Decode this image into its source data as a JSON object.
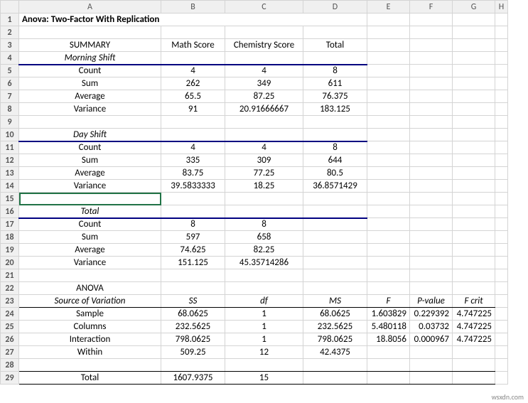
{
  "columns": [
    "A",
    "B",
    "C",
    "D",
    "E",
    "F",
    "G",
    "H"
  ],
  "rows": [
    "1",
    "2",
    "3",
    "4",
    "5",
    "6",
    "7",
    "8",
    "9",
    "10",
    "11",
    "12",
    "13",
    "14",
    "15",
    "16",
    "17",
    "18",
    "19",
    "20",
    "21",
    "22",
    "23",
    "24",
    "25",
    "26",
    "27",
    "28",
    "29"
  ],
  "title": "Anova: Two-Factor With Replication",
  "summary_label": "SUMMARY",
  "headers": {
    "math": "Math Score",
    "chem": "Chemistry Score",
    "total": "Total"
  },
  "sections": {
    "morning": {
      "label": "Morning Shift",
      "count": {
        "label": "Count",
        "b": "4",
        "c": "4",
        "d": "8"
      },
      "sum": {
        "label": "Sum",
        "b": "262",
        "c": "349",
        "d": "611"
      },
      "avg": {
        "label": "Average",
        "b": "65.5",
        "c": "87.25",
        "d": "76.375"
      },
      "var": {
        "label": "Variance",
        "b": "91",
        "c": "20.91666667",
        "d": "183.125"
      }
    },
    "day": {
      "label": "Day Shift",
      "count": {
        "label": "Count",
        "b": "4",
        "c": "4",
        "d": "8"
      },
      "sum": {
        "label": "Sum",
        "b": "335",
        "c": "309",
        "d": "644"
      },
      "avg": {
        "label": "Average",
        "b": "83.75",
        "c": "77.25",
        "d": "80.5"
      },
      "var": {
        "label": "Variance",
        "b": "39.5833333",
        "c": "18.25",
        "d": "36.8571429"
      }
    },
    "total": {
      "label": "Total",
      "count": {
        "label": "Count",
        "b": "8",
        "c": "8"
      },
      "sum": {
        "label": "Sum",
        "b": "597",
        "c": "658"
      },
      "avg": {
        "label": "Average",
        "b": "74.625",
        "c": "82.25"
      },
      "var": {
        "label": "Variance",
        "b": "151.125",
        "c": "45.35714286"
      }
    }
  },
  "anova": {
    "label": "ANOVA",
    "headers": {
      "src": "Source of Variation",
      "ss": "SS",
      "df": "df",
      "ms": "MS",
      "f": "F",
      "p": "P-value",
      "fcrit": "F crit"
    },
    "rows": {
      "sample": {
        "src": "Sample",
        "ss": "68.0625",
        "df": "1",
        "ms": "68.0625",
        "f": "1.603829",
        "p": "0.229392",
        "fcrit": "4.747225"
      },
      "columns": {
        "src": "Columns",
        "ss": "232.5625",
        "df": "1",
        "ms": "232.5625",
        "f": "5.480118",
        "p": "0.03732",
        "fcrit": "4.747225"
      },
      "interaction": {
        "src": "Interaction",
        "ss": "798.0625",
        "df": "1",
        "ms": "798.0625",
        "f": "18.8056",
        "p": "0.000967",
        "fcrit": "4.747225"
      },
      "within": {
        "src": "Within",
        "ss": "509.25",
        "df": "12",
        "ms": "42.4375"
      }
    },
    "total": {
      "src": "Total",
      "ss": "1607.9375",
      "df": "15"
    }
  },
  "watermark": "wsxdn.com",
  "chart_data": {
    "type": "table",
    "title": "Anova: Two-Factor With Replication",
    "summary": [
      {
        "group": "Morning Shift",
        "Math Score": {
          "Count": 4,
          "Sum": 262,
          "Average": 65.5,
          "Variance": 91
        },
        "Chemistry Score": {
          "Count": 4,
          "Sum": 349,
          "Average": 87.25,
          "Variance": 20.91666667
        },
        "Total": {
          "Count": 8,
          "Sum": 611,
          "Average": 76.375,
          "Variance": 183.125
        }
      },
      {
        "group": "Day Shift",
        "Math Score": {
          "Count": 4,
          "Sum": 335,
          "Average": 83.75,
          "Variance": 39.5833333
        },
        "Chemistry Score": {
          "Count": 4,
          "Sum": 309,
          "Average": 77.25,
          "Variance": 18.25
        },
        "Total": {
          "Count": 8,
          "Sum": 644,
          "Average": 80.5,
          "Variance": 36.8571429
        }
      },
      {
        "group": "Total",
        "Math Score": {
          "Count": 8,
          "Sum": 597,
          "Average": 74.625,
          "Variance": 151.125
        },
        "Chemistry Score": {
          "Count": 8,
          "Sum": 658,
          "Average": 82.25,
          "Variance": 45.35714286
        }
      }
    ],
    "anova": [
      {
        "Source": "Sample",
        "SS": 68.0625,
        "df": 1,
        "MS": 68.0625,
        "F": 1.603829,
        "P-value": 0.229392,
        "F crit": 4.747225
      },
      {
        "Source": "Columns",
        "SS": 232.5625,
        "df": 1,
        "MS": 232.5625,
        "F": 5.480118,
        "P-value": 0.03732,
        "F crit": 4.747225
      },
      {
        "Source": "Interaction",
        "SS": 798.0625,
        "df": 1,
        "MS": 798.0625,
        "F": 18.8056,
        "P-value": 0.000967,
        "F crit": 4.747225
      },
      {
        "Source": "Within",
        "SS": 509.25,
        "df": 12,
        "MS": 42.4375
      },
      {
        "Source": "Total",
        "SS": 1607.9375,
        "df": 15
      }
    ]
  }
}
